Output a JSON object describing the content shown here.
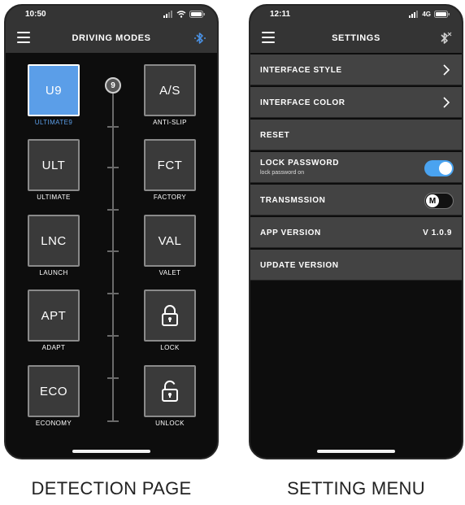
{
  "left_phone": {
    "time": "10:50",
    "title": "DRIVING MODES",
    "slider_value": "9",
    "modes_left": [
      {
        "code": "U9",
        "label": "ULTIMATE9",
        "active": true
      },
      {
        "code": "ULT",
        "label": "ULTIMATE",
        "active": false
      },
      {
        "code": "LNC",
        "label": "LAUNCH",
        "active": false
      },
      {
        "code": "APT",
        "label": "ADAPT",
        "active": false
      },
      {
        "code": "ECO",
        "label": "ECONOMY",
        "active": false
      }
    ],
    "modes_right": [
      {
        "code": "A/S",
        "label": "ANTI-SLIP"
      },
      {
        "code": "FCT",
        "label": "FACTORY"
      },
      {
        "code": "VAL",
        "label": "VALET"
      },
      {
        "code": "",
        "label": "LOCK",
        "icon": "lock-icon"
      },
      {
        "code": "",
        "label": "UNLOCK",
        "icon": "unlock-icon"
      }
    ],
    "caption": "DETECTION PAGE"
  },
  "right_phone": {
    "time": "12:11",
    "network": "4G",
    "title": "SETTINGS",
    "rows": {
      "interface_style": "INTERFACE STYLE",
      "interface_color": "INTERFACE COLOR",
      "reset": "RESET",
      "lock_password": "LOCK PASSWORD",
      "lock_password_sub": "lock password on",
      "transmission": "TRANSMSSION",
      "transmission_toggle_letter": "M",
      "app_version": "APP VERSION",
      "app_version_value": "V 1.0.9",
      "update_version": "UPDATE VERSION"
    },
    "lock_password_on": true,
    "caption": "SETTING MENU"
  },
  "colors": {
    "accent_blue": "#5b9ee8",
    "toggle_blue": "#4aa3f0",
    "bar_gray": "#343434",
    "row_gray": "#434343"
  }
}
